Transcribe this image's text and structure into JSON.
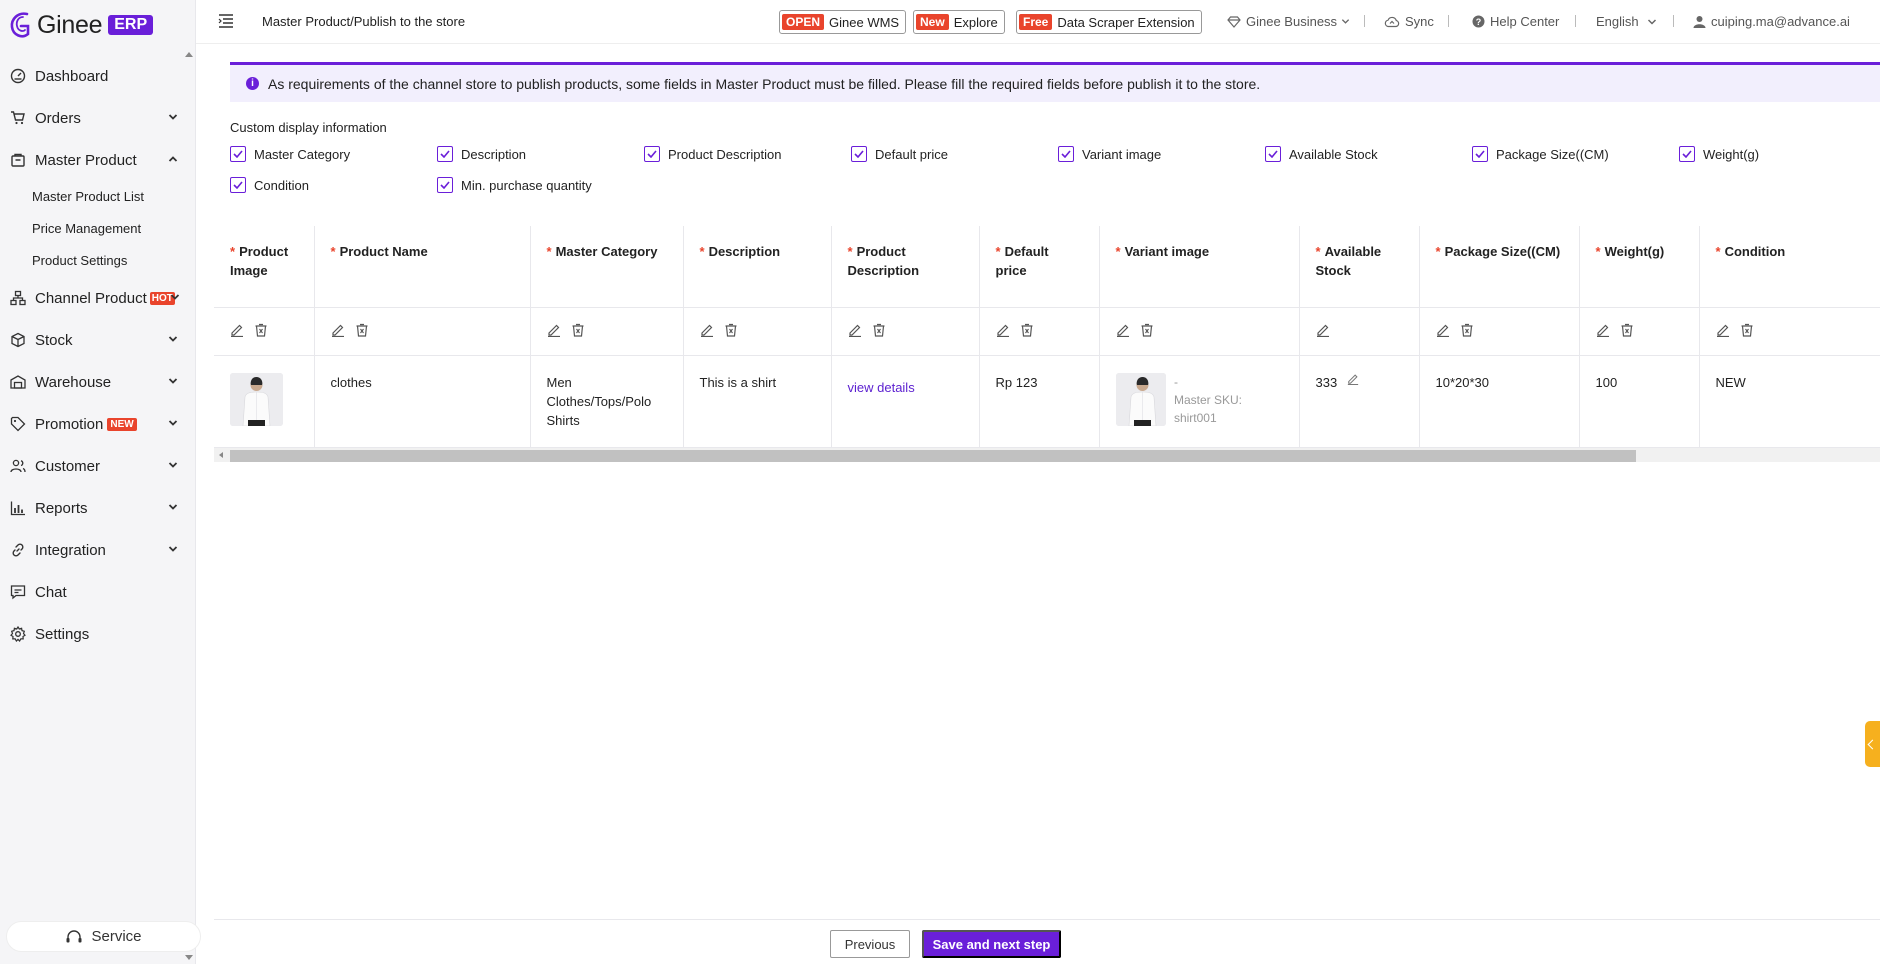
{
  "brand": {
    "name": "Ginee",
    "badge": "ERP"
  },
  "header": {
    "breadcrumb": "Master Product/Publish to the store",
    "promos": [
      {
        "pill": "OPEN",
        "label": "Ginee WMS"
      },
      {
        "pill": "New",
        "label": "Explore"
      },
      {
        "pill": "Free",
        "label": "Data Scraper Extension"
      }
    ],
    "business": "Ginee Business",
    "sync": "Sync",
    "help": "Help Center",
    "language": "English",
    "user": "cuiping.ma@advance.ai"
  },
  "sidebar": {
    "items": [
      {
        "label": "Dashboard"
      },
      {
        "label": "Orders"
      },
      {
        "label": "Master Product"
      },
      {
        "label": "Channel Product",
        "tag": "HOT"
      },
      {
        "label": "Stock"
      },
      {
        "label": "Warehouse"
      },
      {
        "label": "Promotion",
        "tag": "NEW"
      },
      {
        "label": "Customer"
      },
      {
        "label": "Reports"
      },
      {
        "label": "Integration"
      },
      {
        "label": "Chat"
      },
      {
        "label": "Settings"
      }
    ],
    "sub_items": [
      "Master Product List",
      "Price Management",
      "Product Settings"
    ],
    "service": "Service"
  },
  "notice": "As requirements of the channel store to publish products, some fields in Master Product must be filled. Please fill the required fields before publish it to the store.",
  "custom_display": {
    "title": "Custom display information",
    "row1": [
      "Master Category",
      "Description",
      "Product Description",
      "Default price",
      "Variant image",
      "Available Stock",
      "Package Size((CM)",
      "Weight(g)"
    ],
    "row2": [
      "Condition",
      "Min. purchase quantity"
    ]
  },
  "table": {
    "headers": [
      "Product Image",
      "Product Name",
      "Master Category",
      "Description",
      "Product Description",
      "Default price",
      "Variant image",
      "Available Stock",
      "Package Size((CM)",
      "Weight(g)",
      "Condition"
    ],
    "row": {
      "name": "clothes",
      "category": "Men Clothes/Tops/Polo Shirts",
      "description": "This is a shirt",
      "product_description": "view details",
      "price": "Rp 123",
      "variant_dash": "-",
      "variant_sku": "Master SKU: shirt001",
      "stock": "333",
      "package": "10*20*30",
      "weight": "100",
      "condition": "NEW"
    }
  },
  "footer": {
    "previous": "Previous",
    "next": "Save and next step"
  },
  "colors": {
    "accent": "#6a1fd9",
    "badge": "#e9442c"
  }
}
